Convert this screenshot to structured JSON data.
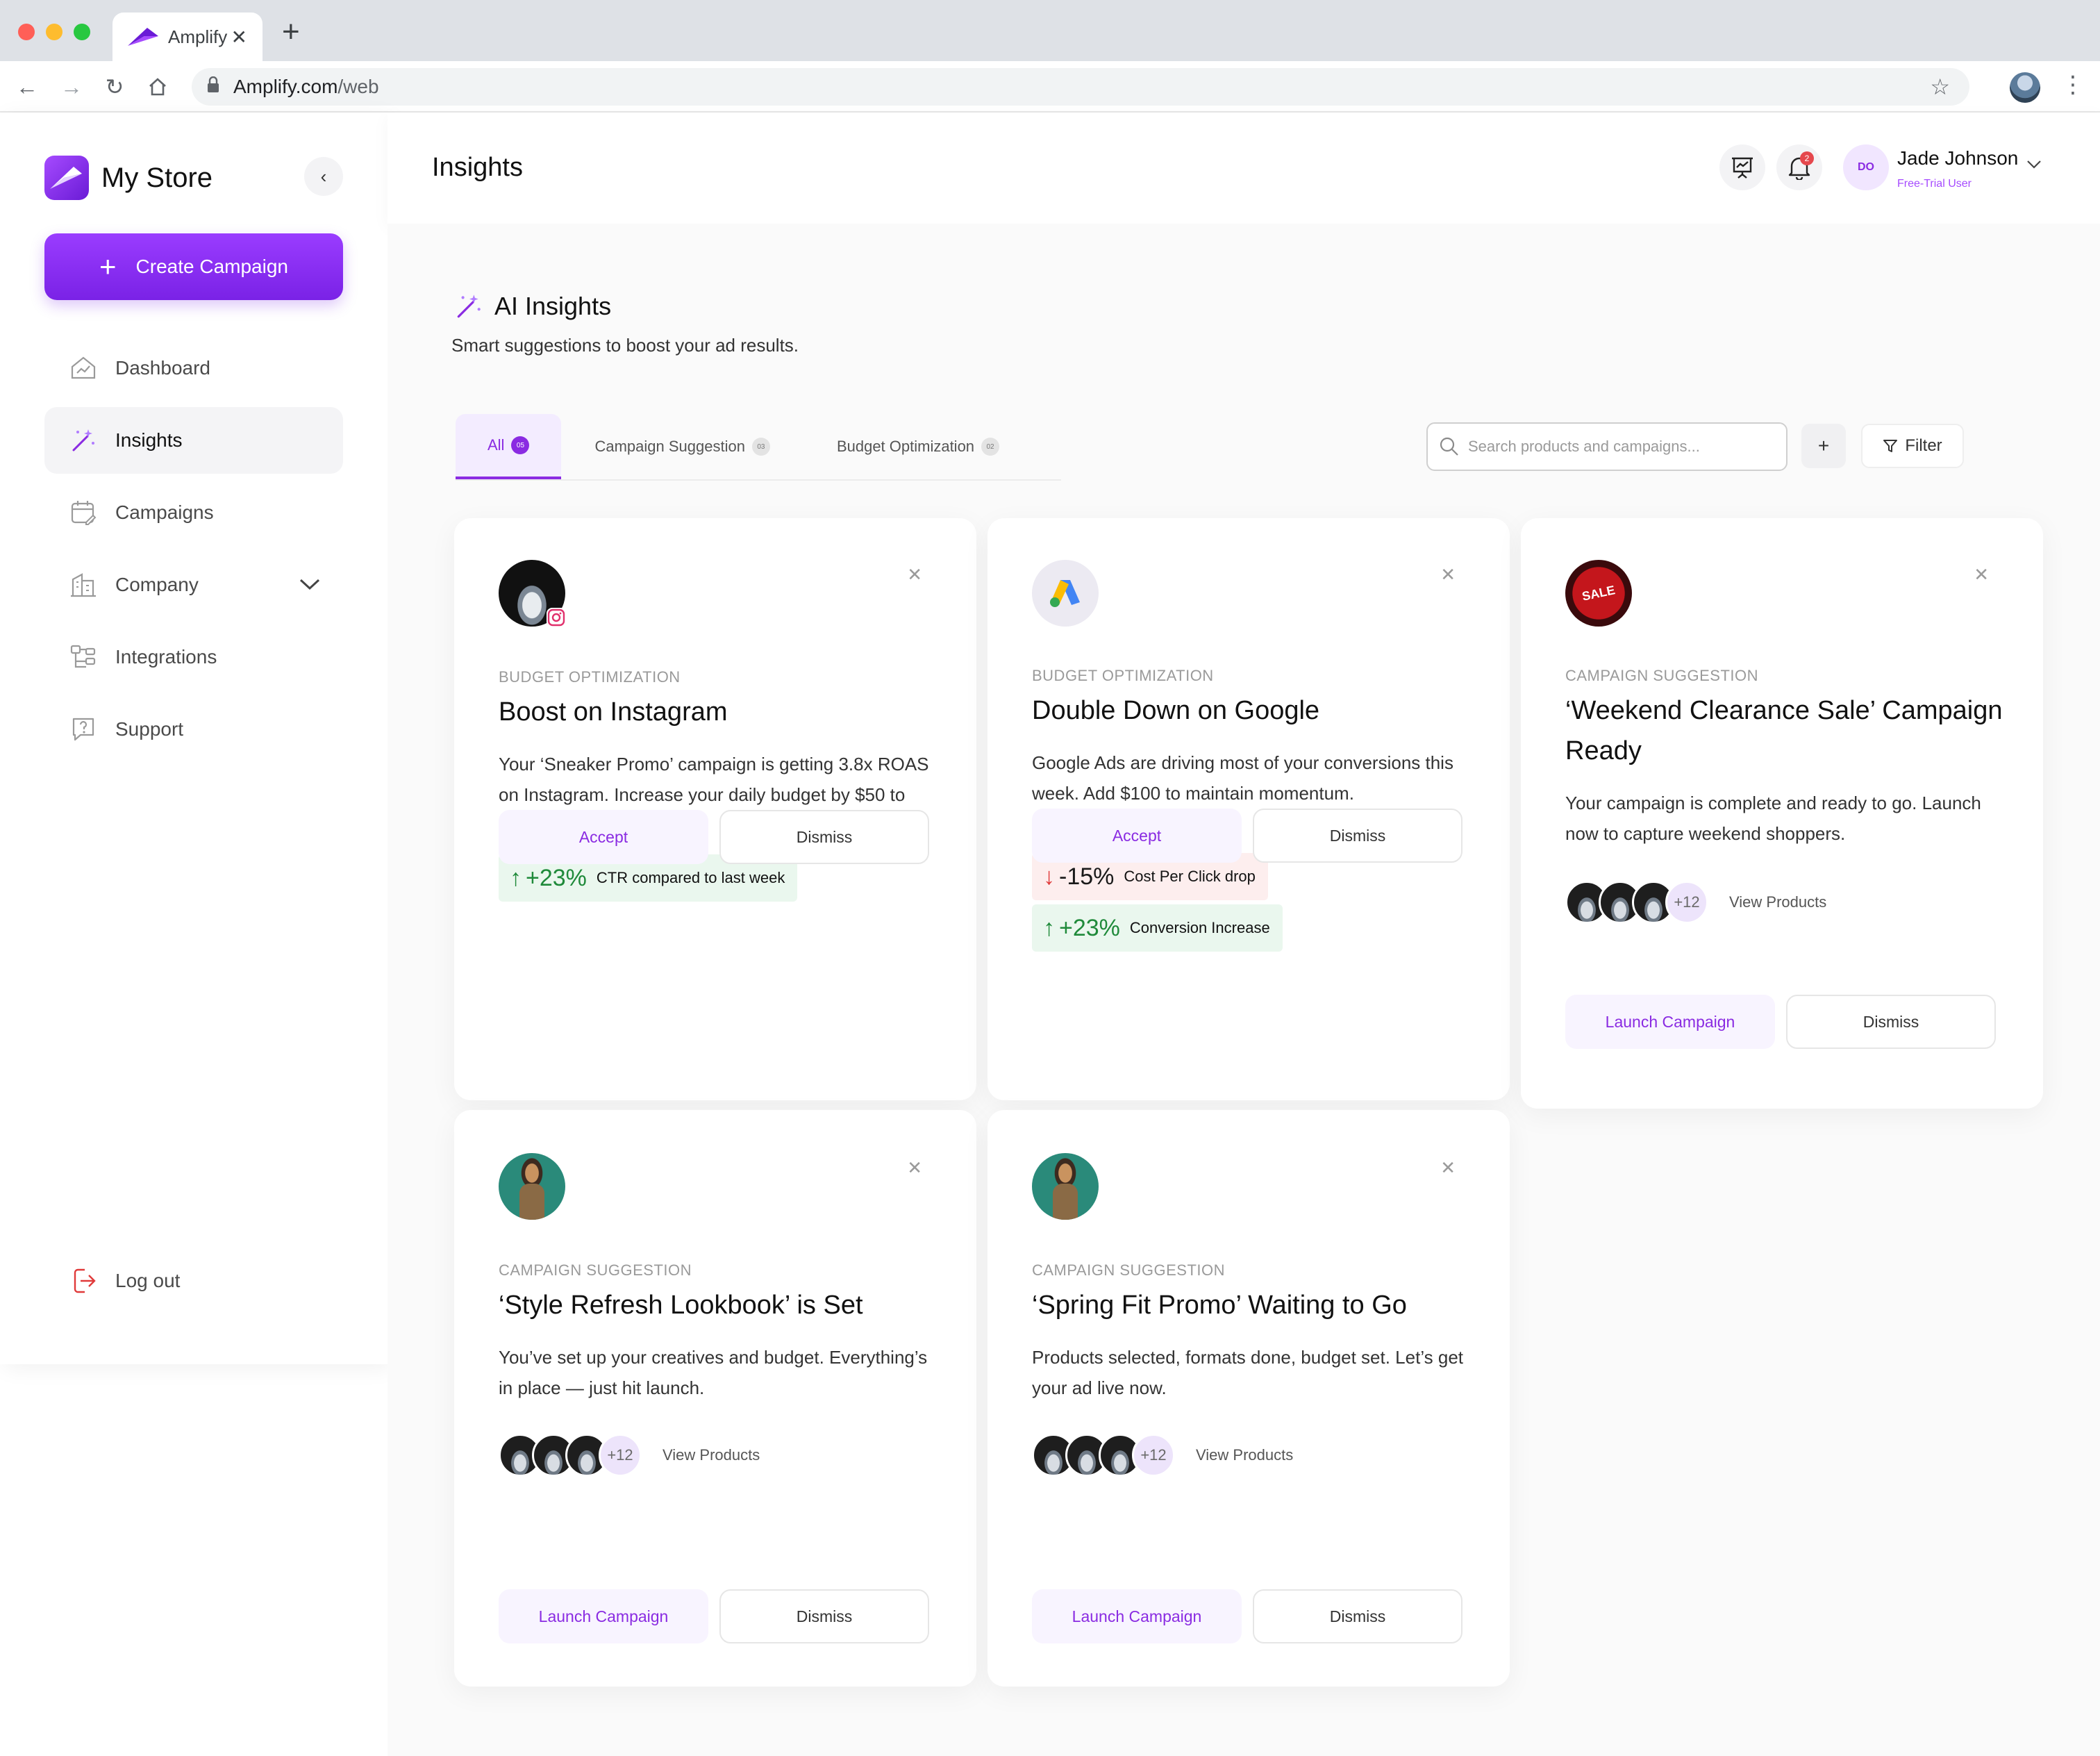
{
  "browser": {
    "tab_title": "Amplify",
    "url_host": "Amplify.com",
    "url_path": "/web"
  },
  "sidebar": {
    "store_name": "My Store",
    "create_label": "Create Campaign",
    "items": [
      {
        "label": "Dashboard",
        "icon": "dashboard-icon"
      },
      {
        "label": "Insights",
        "icon": "magic-wand-icon",
        "active": true
      },
      {
        "label": "Campaigns",
        "icon": "calendar-icon"
      },
      {
        "label": "Company",
        "icon": "building-icon"
      },
      {
        "label": "Integrations",
        "icon": "integrations-icon"
      },
      {
        "label": "Support",
        "icon": "help-icon"
      }
    ],
    "logout_label": "Log out"
  },
  "header": {
    "title": "Insights",
    "notification_count": "2",
    "user": {
      "initials": "DO",
      "name": "Jade Johnson",
      "role": "Free-Trial User"
    }
  },
  "ai": {
    "title": "AI Insights",
    "subtitle": "Smart suggestions to boost your ad results."
  },
  "tabs": [
    {
      "label": "All",
      "count": "05"
    },
    {
      "label": "Campaign Suggestion",
      "count": "03"
    },
    {
      "label": "Budget Optimization",
      "count": "02"
    }
  ],
  "search": {
    "placeholder": "Search products and campaigns..."
  },
  "add_label": "+",
  "filter_label": "Filter",
  "colors": {
    "accent": "#8a2be2",
    "positive": "#1f8a3a",
    "negative": "#e03a3a"
  },
  "cards": [
    {
      "category": "BUDGET OPTIMIZATION",
      "title": "Boost on Instagram",
      "description": "Your ‘Sneaker Promo’ campaign is getting 3.8x ROAS on Instagram. Increase your daily budget by $50 to scale results.",
      "metrics": [
        {
          "value": "+23%",
          "label": "CTR compared to last week",
          "direction": "up"
        }
      ],
      "primary": "Accept",
      "secondary": "Dismiss"
    },
    {
      "category": "BUDGET OPTIMIZATION",
      "title": "Double Down on Google",
      "description": "Google Ads are driving most of your conversions this week. Add $100 to maintain momentum.",
      "metrics": [
        {
          "value": "-15%",
          "label": "Cost Per Click drop",
          "direction": "down"
        },
        {
          "value": "+23%",
          "label": "Conversion Increase",
          "direction": "up"
        }
      ],
      "primary": "Accept",
      "secondary": "Dismiss"
    },
    {
      "category": "CAMPAIGN SUGGESTION",
      "title": "‘Weekend Clearance Sale’ Campaign Ready",
      "description": "Your campaign is complete and ready to go. Launch now to capture weekend shoppers.",
      "more_count": "+12",
      "view_label": "View Products",
      "sale_badge": "SALE",
      "primary": "Launch Campaign",
      "secondary": "Dismiss"
    },
    {
      "category": "CAMPAIGN SUGGESTION",
      "title": "‘Style Refresh Lookbook’ is Set",
      "description": "You’ve set up your creatives and budget. Everything’s in place — just hit launch.",
      "more_count": "+12",
      "view_label": "View Products",
      "primary": "Launch Campaign",
      "secondary": "Dismiss"
    },
    {
      "category": "CAMPAIGN SUGGESTION",
      "title": "‘Spring Fit Promo’ Waiting to Go",
      "description": "Products selected, formats done, budget set. Let’s get your ad live now.",
      "more_count": "+12",
      "view_label": "View Products",
      "primary": "Launch Campaign",
      "secondary": "Dismiss"
    }
  ]
}
